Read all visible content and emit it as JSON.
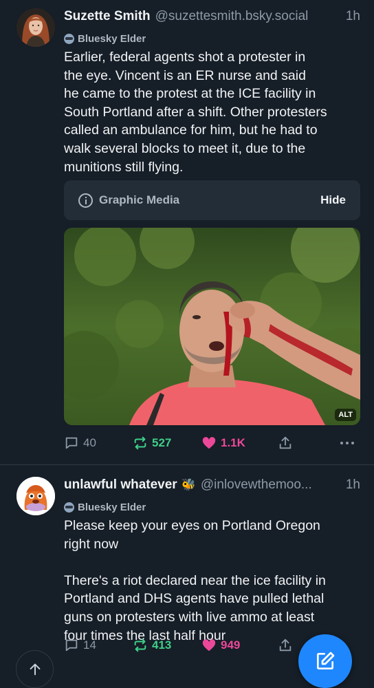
{
  "posts": [
    {
      "author_name": "Suzette Smith",
      "handle": "@suzettesmith.bsky.social",
      "time": "1h",
      "badge": "Bluesky Elder",
      "text": "Earlier, federal agents shot a protester in\nthe eye. Vincent is an ER nurse and said\nhe came to the protest at the ICE facility in\nSouth Portland after a shift. Other protesters\ncalled an ambulance for him, but he had to\nwalk several blocks to meet it, due to the\nmunitions still flying.",
      "content_warning": {
        "label": "Graphic Media",
        "action": "Hide",
        "icon": "info-icon"
      },
      "image_alt_badge": "ALT",
      "counts": {
        "replies": "40",
        "reposts": "527",
        "likes": "1.1K"
      }
    },
    {
      "author_name": "unlawful whatever",
      "author_emoji": "🐝",
      "handle": "@inlovewthemoo...",
      "time": "1h",
      "badge": "Bluesky Elder",
      "text": "Please keep your eyes on Portland Oregon\nright now\n\nThere's a riot declared near the ice facility in\nPortland and DHS agents have pulled lethal\nguns on protesters with live ammo at least\nfour times the last half hour",
      "counts": {
        "replies": "14",
        "reposts": "413",
        "likes": "949"
      }
    }
  ],
  "colors": {
    "background": "#161e27",
    "repost": "#3fcf88",
    "like": "#ec4899",
    "fab": "#1f87fd",
    "muted": "#8d9aa8"
  },
  "icons": {
    "reply": "speech-bubble-icon",
    "repost": "repost-arrows-icon",
    "like": "heart-icon",
    "share": "share-upload-icon",
    "more": "ellipsis-icon",
    "compose": "compose-pencil-icon",
    "scroll_top": "arrow-up-icon"
  }
}
